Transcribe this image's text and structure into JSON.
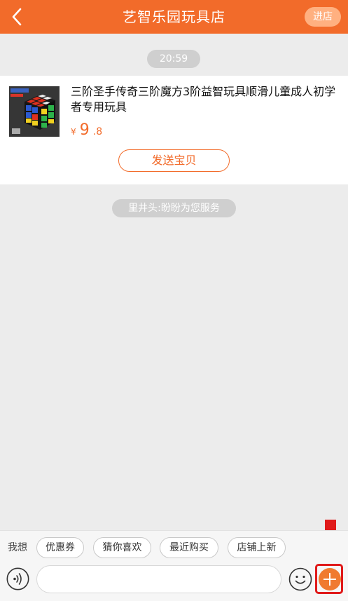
{
  "header": {
    "title": "艺智乐园玩具店",
    "store_button": "进店",
    "back_icon": "chevron-left-icon"
  },
  "chat": {
    "timestamp": "20:59",
    "product": {
      "name": "三阶圣手传奇三阶魔方3阶益智玩具顺滑儿童成人初学者专用玩具",
      "price_symbol": "¥",
      "price_integer": "9",
      "price_decimal": ".8",
      "send_button": "发送宝贝",
      "thumbnail": "rubiks-cube-image"
    },
    "system_notice": "里井头:盼盼为您服务"
  },
  "quick_replies": {
    "label": "我想",
    "chips": [
      "优惠券",
      "猜你喜欢",
      "最近购买",
      "店铺上新"
    ]
  },
  "composer": {
    "input_value": "",
    "input_placeholder": "",
    "voice_icon": "voice-icon",
    "emoji_icon": "smiley-icon",
    "plus_icon": "plus-icon"
  },
  "colors": {
    "brand_orange": "#f26b2a",
    "annotation_red": "#e01a1a",
    "background": "#ececec"
  }
}
